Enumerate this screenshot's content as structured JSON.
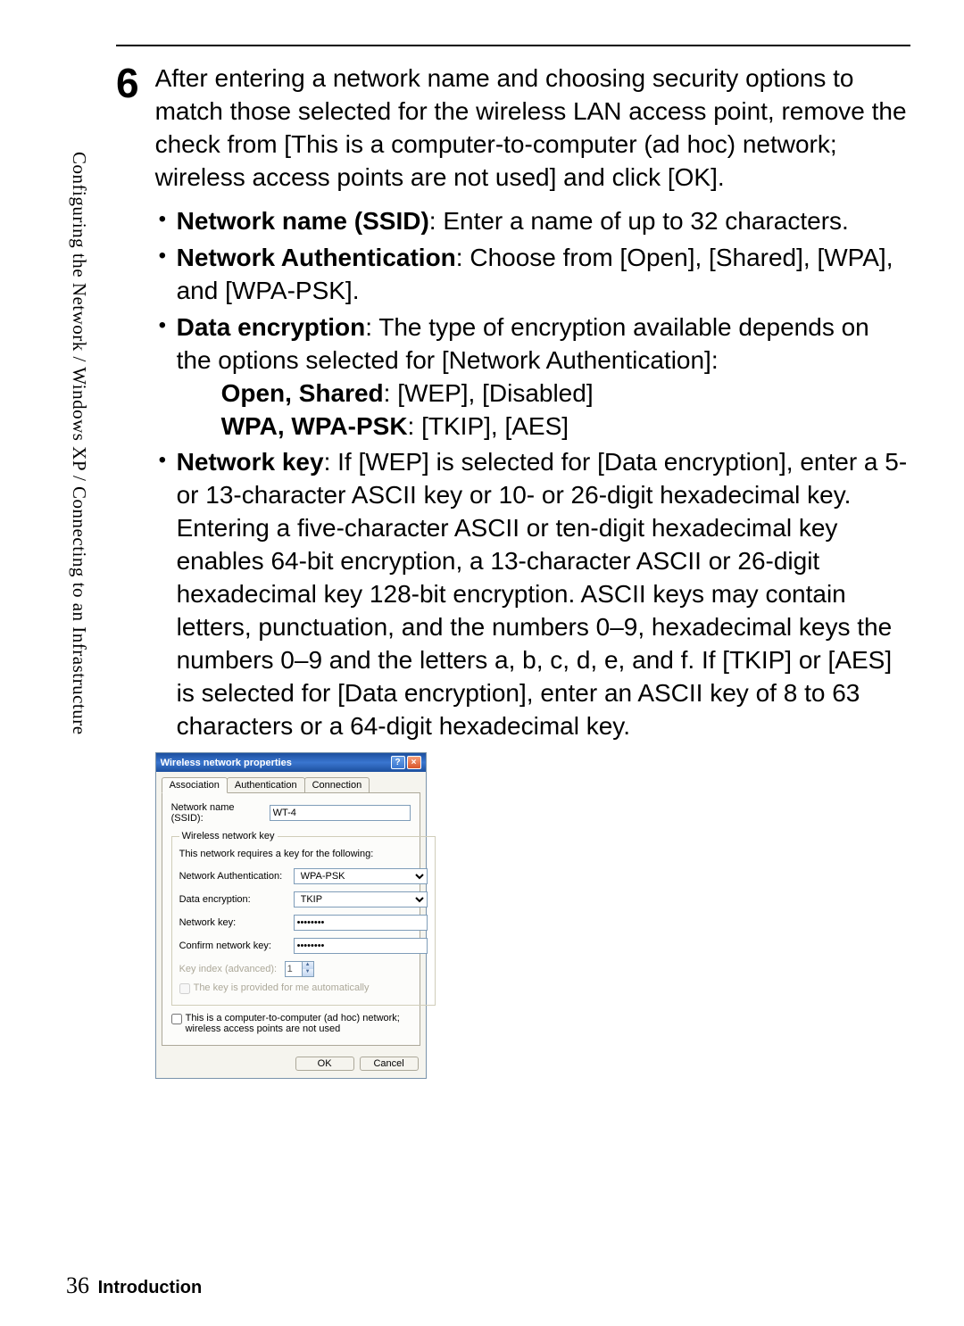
{
  "sidebar_text": "Configuring the Network / Windows XP / Connecting to an Infrastructure",
  "step": {
    "number": "6",
    "intro": "After entering a network name and choosing security options to match those selected for the wireless LAN access point, remove the check from [This is a computer-to-computer (ad hoc) network; wireless access points are not used] and click [OK].",
    "bullets": {
      "b1_label": "Network name (SSID)",
      "b1_text": ": Enter a name of up to 32 characters.",
      "b2_label": "Network Authentication",
      "b2_text": ": Choose from [Open], [Shared], [WPA], and [WPA-PSK].",
      "b3_label": "Data encryption",
      "b3_text": ": The type of encryption available depends on the options selected for [Network Authentication]:",
      "b3_sub1_label": "Open, Shared",
      "b3_sub1_text": ": [WEP], [Disabled]",
      "b3_sub2_label": "WPA, WPA-PSK",
      "b3_sub2_text": ": [TKIP], [AES]",
      "b4_label": "Network key",
      "b4_text": ": If [WEP] is selected for [Data encryption], enter a 5- or 13-character ASCII key or 10- or 26-digit hexadecimal key.  Entering a five-character ASCII or ten-digit hexadecimal key enables 64-bit encryption, a 13-character ASCII or 26-digit hexadecimal key 128-bit encryption.  ASCII keys may contain letters, punctuation, and the numbers 0–9, hexadecimal keys the numbers 0–9 and the letters a, b, c, d, e, and f.  If [TKIP] or [AES] is selected for [Data encryption], enter an ASCII key of 8 to 63 characters or a 64-digit hexadecimal key."
    }
  },
  "dialog": {
    "title": "Wireless network properties",
    "tabs": {
      "t1": "Association",
      "t2": "Authentication",
      "t3": "Connection"
    },
    "ssid_label": "Network name (SSID):",
    "ssid_value": "WT-4",
    "fieldset_legend": "Wireless network key",
    "fieldset_text": "This network requires a key for the following:",
    "auth_label": "Network Authentication:",
    "auth_value": "WPA-PSK",
    "enc_label": "Data encryption:",
    "enc_value": "TKIP",
    "key_label": "Network key:",
    "key_value": "••••••••",
    "confirm_label": "Confirm network key:",
    "confirm_value": "••••••••",
    "keyindex_label": "Key index (advanced):",
    "keyindex_value": "1",
    "autokey_label": "The key is provided for me automatically",
    "adhoc_label": "This is a computer-to-computer (ad hoc) network; wireless access points are not used",
    "ok": "OK",
    "cancel": "Cancel"
  },
  "footer": {
    "page": "36",
    "section": "Introduction"
  }
}
